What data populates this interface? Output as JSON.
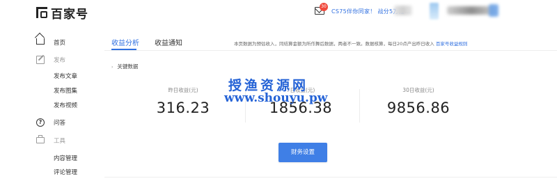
{
  "header": {
    "logo_text": "百家号",
    "mail_badge": "30",
    "promo_text": "CS75伴你同家！ 战分5万红..."
  },
  "sidebar": {
    "items": [
      {
        "label": "首页",
        "icon": "home-icon"
      },
      {
        "label": "发布",
        "icon": "edit-icon"
      },
      {
        "label": "发布文章"
      },
      {
        "label": "发布图集"
      },
      {
        "label": "发布视频"
      },
      {
        "label": "问答",
        "icon": "question-icon"
      },
      {
        "label": "工具",
        "icon": "toolbox-icon"
      },
      {
        "label": "内容管理"
      },
      {
        "label": "评论管理"
      }
    ]
  },
  "main": {
    "tabs": [
      {
        "label": "收益分析",
        "active": true
      },
      {
        "label": "收益通知",
        "active": false
      }
    ],
    "notice": "本页数据为预估收入，同结算金额为所作舞后数据，两者不一致。数据核算，每日20点产出昨日收入",
    "notice_link": "百家号收益规则",
    "section_label": "关键数据",
    "stats": [
      {
        "label": "昨日收益(元)",
        "value": "316.23"
      },
      {
        "label": "7日收益(元)",
        "value": "1856.38"
      },
      {
        "label": "30日收益(元)",
        "value": "9856.86"
      }
    ],
    "button_label": "财务设置"
  },
  "watermark": {
    "cn": "授渔资源网",
    "en": "www.shouyu.pw"
  },
  "colors": {
    "accent": "#2f6fe0",
    "button": "#3f7fe6",
    "badge": "#f04a3d",
    "watermark": "#2563d6"
  }
}
